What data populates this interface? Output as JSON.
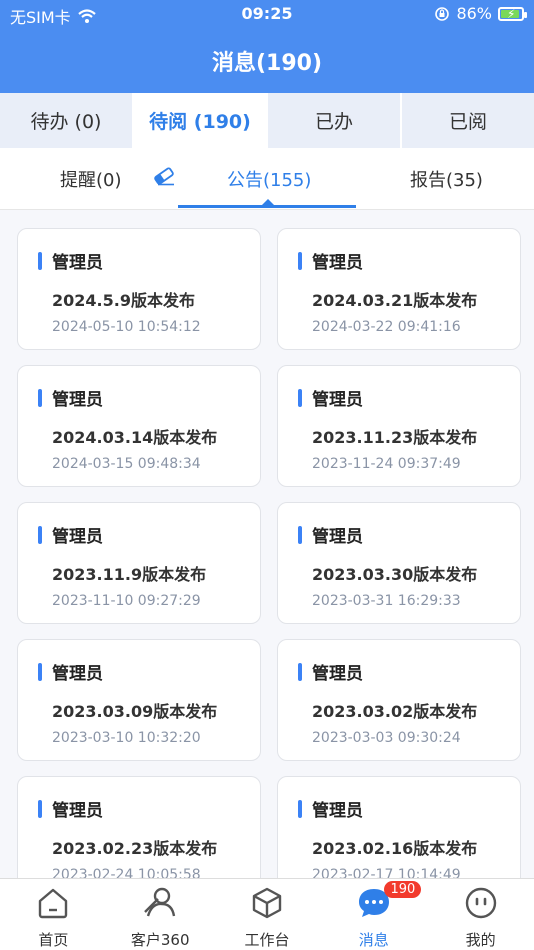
{
  "status": {
    "carrier": "无SIM卡",
    "time": "09:25",
    "battery": "86%"
  },
  "title": "消息(190)",
  "tabs": [
    {
      "label": "待办 (0)"
    },
    {
      "label": "待阅 (190)"
    },
    {
      "label": "已办"
    },
    {
      "label": "已阅"
    }
  ],
  "subtabs": [
    {
      "label": "提醒(0)"
    },
    {
      "label": "公告(155)"
    },
    {
      "label": "报告(35)"
    }
  ],
  "cards": [
    {
      "author": "管理员",
      "title": "2024.5.9版本发布",
      "time": "2024-05-10 10:54:12"
    },
    {
      "author": "管理员",
      "title": "2024.03.21版本发布",
      "time": "2024-03-22 09:41:16"
    },
    {
      "author": "管理员",
      "title": "2024.03.14版本发布",
      "time": "2024-03-15 09:48:34"
    },
    {
      "author": "管理员",
      "title": "2023.11.23版本发布",
      "time": "2023-11-24 09:37:49"
    },
    {
      "author": "管理员",
      "title": "2023.11.9版本发布",
      "time": "2023-11-10 09:27:29"
    },
    {
      "author": "管理员",
      "title": "2023.03.30版本发布",
      "time": "2023-03-31 16:29:33"
    },
    {
      "author": "管理员",
      "title": "2023.03.09版本发布",
      "time": "2023-03-10 10:32:20"
    },
    {
      "author": "管理员",
      "title": "2023.03.02版本发布",
      "time": "2023-03-03 09:30:24"
    },
    {
      "author": "管理员",
      "title": "2023.02.23版本发布",
      "time": "2023-02-24 10:05:58"
    },
    {
      "author": "管理员",
      "title": "2023.02.16版本发布",
      "time": "2023-02-17 10:14:49"
    }
  ],
  "bottom_nav": [
    {
      "label": "首页",
      "icon": "home-icon"
    },
    {
      "label": "客户360",
      "icon": "customer-icon"
    },
    {
      "label": "工作台",
      "icon": "workbench-icon"
    },
    {
      "label": "消息",
      "icon": "message-icon",
      "badge": "190"
    },
    {
      "label": "我的",
      "icon": "profile-icon"
    }
  ],
  "colors": {
    "header": "#4b8df1",
    "accent": "#2f7fe8",
    "badge": "#f23a2c"
  }
}
